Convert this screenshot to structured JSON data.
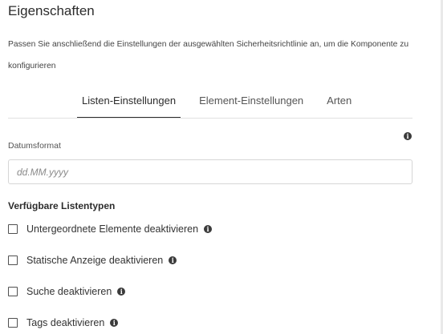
{
  "panel": {
    "title": "Eigenschaften",
    "description": "Passen Sie anschließend die Einstellungen der ausgewählten Sicherheitsrichtlinie an, um die Komponente zu konfigurieren"
  },
  "tabs": [
    {
      "label": "Listen-Einstellungen",
      "active": true
    },
    {
      "label": "Element-Einstellungen",
      "active": false
    },
    {
      "label": "Arten",
      "active": false
    }
  ],
  "date_format": {
    "label": "Datumsformat",
    "placeholder": "dd.MM.yyyy",
    "value": ""
  },
  "list_types": {
    "title": "Verfügbare Listentypen",
    "options": [
      {
        "label": "Untergeordnete Elemente deaktivieren",
        "checked": false
      },
      {
        "label": "Statische Anzeige deaktivieren",
        "checked": false
      },
      {
        "label": "Suche deaktivieren",
        "checked": false
      },
      {
        "label": "Tags deaktivieren",
        "checked": false
      }
    ]
  },
  "icons": {
    "info": "info-icon",
    "checkbox": "checkbox-unchecked-icon"
  },
  "colors": {
    "text": "#2c2c2c",
    "divider": "#e1e1e1",
    "border": "#d6d6d6"
  }
}
